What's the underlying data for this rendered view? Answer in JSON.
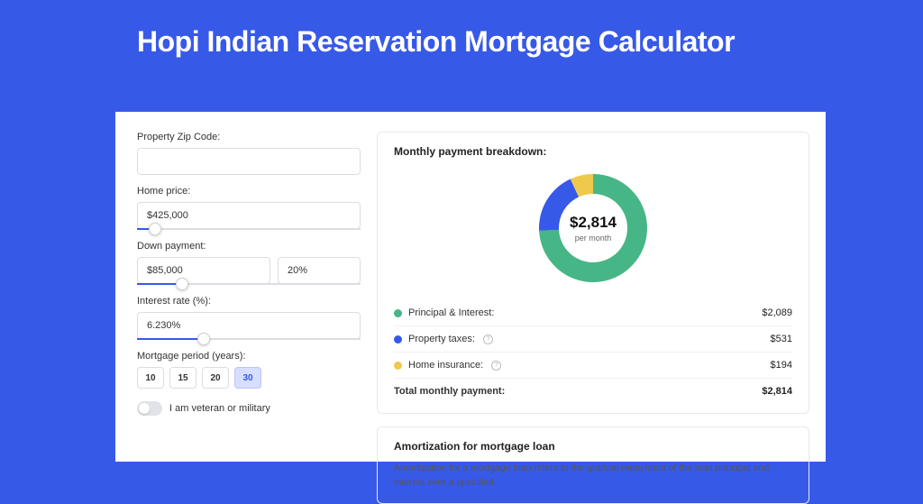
{
  "page": {
    "title": "Hopi Indian Reservation Mortgage Calculator"
  },
  "form": {
    "zip": {
      "label": "Property Zip Code:",
      "value": ""
    },
    "price": {
      "label": "Home price:",
      "value": "$425,000",
      "slider_pct": 8
    },
    "down": {
      "label": "Down payment:",
      "amount": "$85,000",
      "percent": "20%",
      "slider_pct": 20
    },
    "rate": {
      "label": "Interest rate (%):",
      "value": "6.230%",
      "slider_pct": 30
    },
    "period": {
      "label": "Mortgage period (years):",
      "options": [
        "10",
        "15",
        "20",
        "30"
      ],
      "selected": "30"
    },
    "veteran": {
      "label": "I am veteran or military",
      "on": false
    }
  },
  "breakdown": {
    "title": "Monthly payment breakdown:",
    "center_amount": "$2,814",
    "center_sub": "per month",
    "items": [
      {
        "label": "Principal & Interest:",
        "amount": "$2,089",
        "color": "#46B686",
        "info": false
      },
      {
        "label": "Property taxes:",
        "amount": "$531",
        "color": "#3759E8",
        "info": true
      },
      {
        "label": "Home insurance:",
        "amount": "$194",
        "color": "#EFC94C",
        "info": true
      }
    ],
    "total": {
      "label": "Total monthly payment:",
      "amount": "$2,814"
    }
  },
  "chart_data": {
    "type": "pie",
    "title": "Monthly payment breakdown",
    "center_label": "$2,814 per month",
    "series": [
      {
        "name": "Principal & Interest",
        "value": 2089,
        "color": "#46B686"
      },
      {
        "name": "Property taxes",
        "value": 531,
        "color": "#3759E8"
      },
      {
        "name": "Home insurance",
        "value": 194,
        "color": "#EFC94C"
      }
    ],
    "total": 2814
  },
  "amort": {
    "title": "Amortization for mortgage loan",
    "text": "Amortization for a mortgage loan refers to the gradual repayment of the loan principal and interest over a specified"
  }
}
